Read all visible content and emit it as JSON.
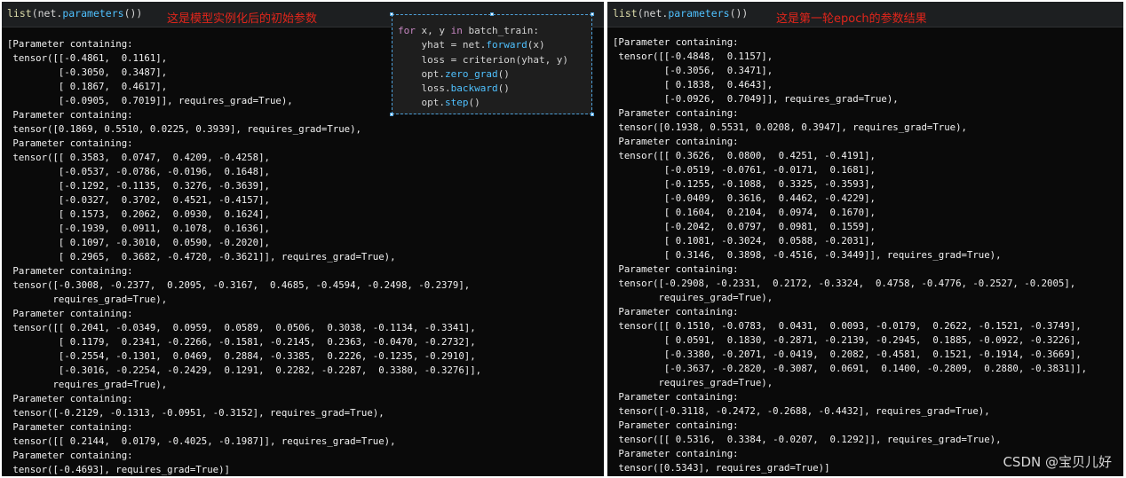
{
  "left": {
    "cell_code": "list(net.parameters())",
    "annotation": "这是模型实例化后的初始参数",
    "output": "[Parameter containing:\n tensor([[-0.4861,  0.1161],\n         [-0.3050,  0.3487],\n         [ 0.1867,  0.4617],\n         [-0.0905,  0.7019]], requires_grad=True),\n Parameter containing:\n tensor([0.1869, 0.5510, 0.0225, 0.3939], requires_grad=True),\n Parameter containing:\n tensor([[ 0.3583,  0.0747,  0.4209, -0.4258],\n         [-0.0537, -0.0786, -0.0196,  0.1648],\n         [-0.1292, -0.1135,  0.3276, -0.3639],\n         [-0.0327,  0.3702,  0.4521, -0.4157],\n         [ 0.1573,  0.2062,  0.0930,  0.1624],\n         [-0.1939,  0.0911,  0.1078,  0.1636],\n         [ 0.1097, -0.3010,  0.0590, -0.2020],\n         [ 0.2965,  0.3682, -0.4720, -0.3621]], requires_grad=True),\n Parameter containing:\n tensor([-0.3008, -0.2377,  0.2095, -0.3167,  0.4685, -0.4594, -0.2498, -0.2379],\n        requires_grad=True),\n Parameter containing:\n tensor([[ 0.2041, -0.0349,  0.0959,  0.0589,  0.0506,  0.3038, -0.1134, -0.3341],\n         [ 0.1179,  0.2341, -0.2266, -0.1581, -0.2145,  0.2363, -0.0470, -0.2732],\n         [-0.2554, -0.1301,  0.0469,  0.2884, -0.3385,  0.2226, -0.1235, -0.2910],\n         [-0.3016, -0.2254, -0.2429,  0.1291,  0.2282, -0.2287,  0.3380, -0.3276]],\n        requires_grad=True),\n Parameter containing:\n tensor([-0.2129, -0.1313, -0.0951, -0.3152], requires_grad=True),\n Parameter containing:\n tensor([[ 0.2144,  0.0179, -0.4025, -0.1987]], requires_grad=True),\n Parameter containing:\n tensor([-0.4693], requires_grad=True)]"
  },
  "popup": {
    "lines": [
      {
        "kw": "for",
        "rest": " x, y ",
        "kw2": "in",
        "rest2": " batch_train:"
      },
      {
        "pre": "    yhat = net.",
        "call": "forward",
        "post": "(x)"
      },
      {
        "pre": "    loss = criterion(yhat, y)",
        "call": "",
        "post": ""
      },
      {
        "pre": "    opt.",
        "call": "zero_grad",
        "post": "()"
      },
      {
        "pre": "    loss.",
        "call": "backward",
        "post": "()"
      },
      {
        "pre": "    opt.",
        "call": "step",
        "post": "()"
      }
    ]
  },
  "right": {
    "cell_code": "list(net.parameters())",
    "annotation": "这是第一轮epoch的参数结果",
    "output": "[Parameter containing:\n tensor([[-0.4848,  0.1157],\n         [-0.3056,  0.3471],\n         [ 0.1838,  0.4643],\n         [-0.0926,  0.7049]], requires_grad=True),\n Parameter containing:\n tensor([0.1938, 0.5531, 0.0208, 0.3947], requires_grad=True),\n Parameter containing:\n tensor([[ 0.3626,  0.0800,  0.4251, -0.4191],\n         [-0.0519, -0.0761, -0.0171,  0.1681],\n         [-0.1255, -0.1088,  0.3325, -0.3593],\n         [-0.0409,  0.3616,  0.4462, -0.4229],\n         [ 0.1604,  0.2104,  0.0974,  0.1670],\n         [-0.2042,  0.0797,  0.0981,  0.1559],\n         [ 0.1081, -0.3024,  0.0588, -0.2031],\n         [ 0.3146,  0.3898, -0.4516, -0.3449]], requires_grad=True),\n Parameter containing:\n tensor([-0.2908, -0.2331,  0.2172, -0.3324,  0.4758, -0.4776, -0.2527, -0.2005],\n        requires_grad=True),\n Parameter containing:\n tensor([[ 0.1510, -0.0783,  0.0431,  0.0093, -0.0179,  0.2622, -0.1521, -0.3749],\n         [ 0.0591,  0.1830, -0.2871, -0.2139, -0.2945,  0.1885, -0.0922, -0.3226],\n         [-0.3380, -0.2071, -0.0419,  0.2082, -0.4581,  0.1521, -0.1914, -0.3669],\n         [-0.3637, -0.2820, -0.3087,  0.0691,  0.1400, -0.2809,  0.2880, -0.3831]],\n        requires_grad=True),\n Parameter containing:\n tensor([-0.3118, -0.2472, -0.2688, -0.4432], requires_grad=True),\n Parameter containing:\n tensor([[ 0.5316,  0.3384, -0.0207,  0.1292]], requires_grad=True),\n Parameter containing:\n tensor([0.5343], requires_grad=True)]"
  },
  "watermark": "CSDN @宝贝儿好",
  "colors": {
    "background": "#0a0a0a",
    "annotation": "#e0251b",
    "keyword": "#c586c0",
    "method": "#4fc1ff",
    "function": "#dcdcaa"
  }
}
